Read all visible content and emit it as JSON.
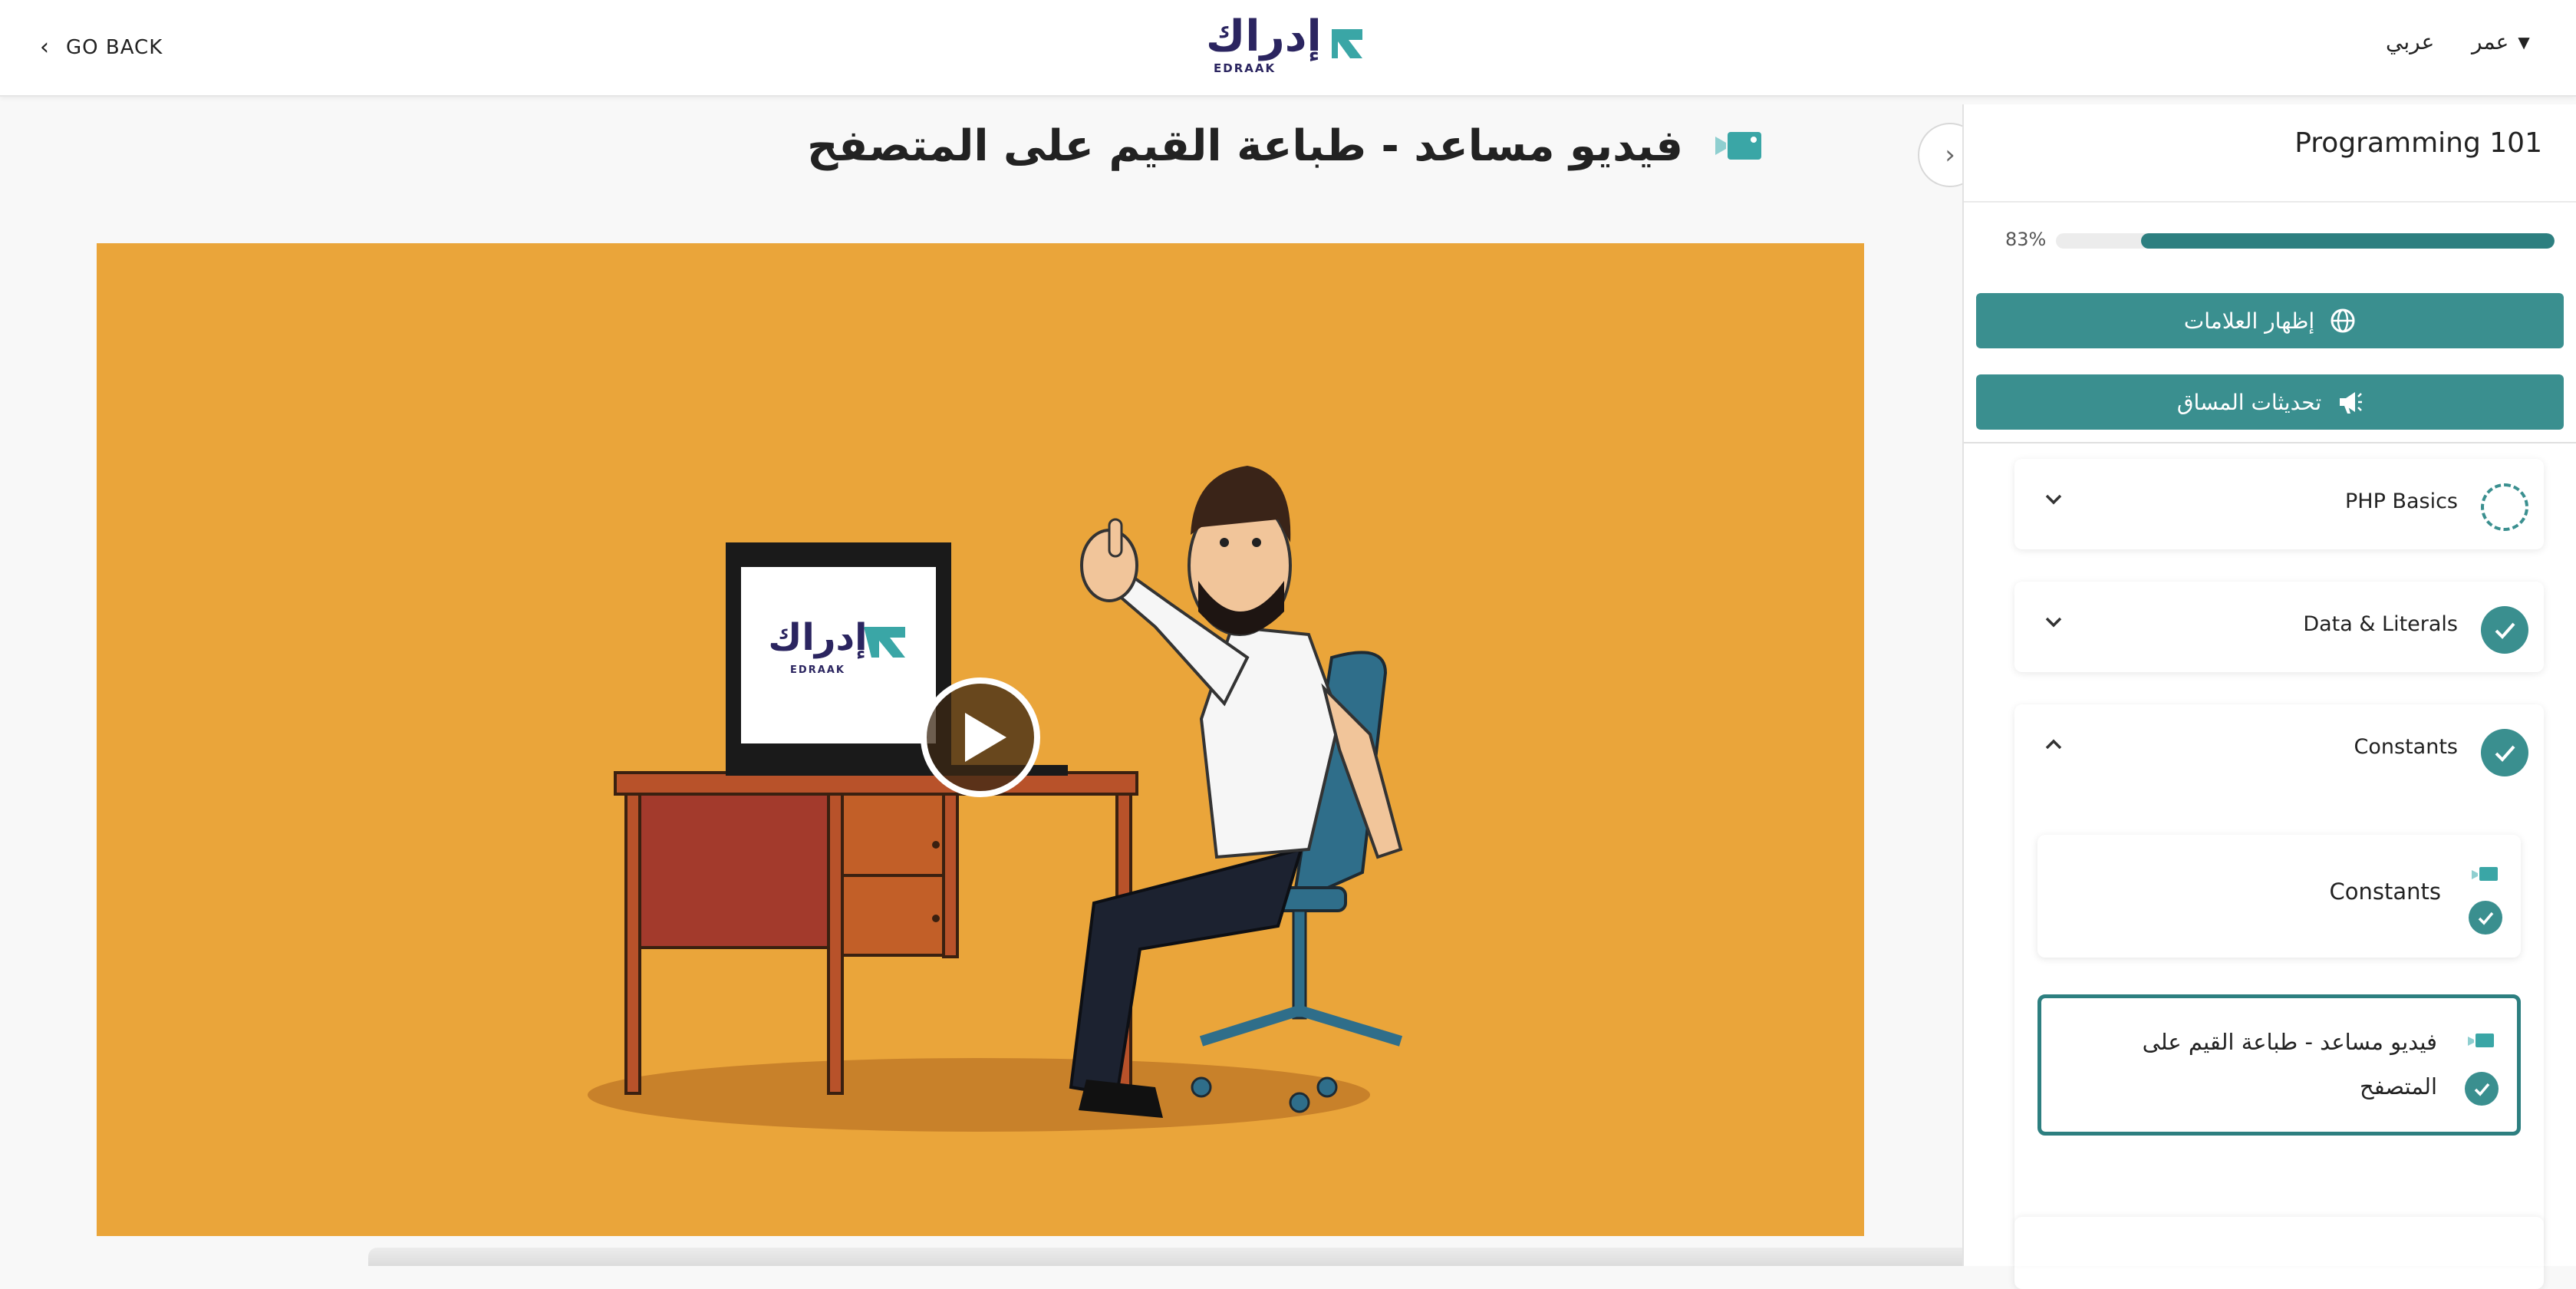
{
  "header": {
    "go_back_label": "GO BACK",
    "logo_arabic": "إدراك",
    "logo_english": "EDRAAK",
    "language_label": "عربي",
    "user_name": "عمر"
  },
  "main": {
    "title": "فيديو مساعد - طباعة القيم على المتصفح",
    "video": {
      "logo_arabic": "إدراك",
      "logo_english": "EDRAAK"
    }
  },
  "sidebar": {
    "course_title": "Programming 101",
    "progress": {
      "label": "83%",
      "fraction": 0.83
    },
    "buttons": {
      "show_marks": "إظهار العلامات",
      "course_updates": "تحديثات المساق"
    },
    "modules": [
      {
        "name": "PHP Basics",
        "status": "in-progress",
        "expanded": false
      },
      {
        "name": "Data & Literals",
        "status": "complete",
        "expanded": false
      },
      {
        "name": "Constants",
        "status": "complete",
        "expanded": true,
        "units": [
          {
            "name": "Constants",
            "type": "video",
            "complete": true,
            "active": false
          },
          {
            "name": "فيديو مساعد - طباعة القيم على المتصفح",
            "type": "video",
            "complete": true,
            "active": true
          }
        ]
      }
    ]
  },
  "colors": {
    "accent": "#3a8f8f",
    "accent_dark": "#2d7f80",
    "video_background": "#eaa53a",
    "logo": "#2b2560"
  },
  "icons": {
    "go_back": "chevron-left-icon",
    "user_menu": "caret-down-icon",
    "title_video": "video-camera-icon",
    "collapse_sidebar": "chevron-right-icon",
    "show_marks": "globe-icon",
    "course_updates": "megaphone-icon",
    "play": "play-icon"
  }
}
